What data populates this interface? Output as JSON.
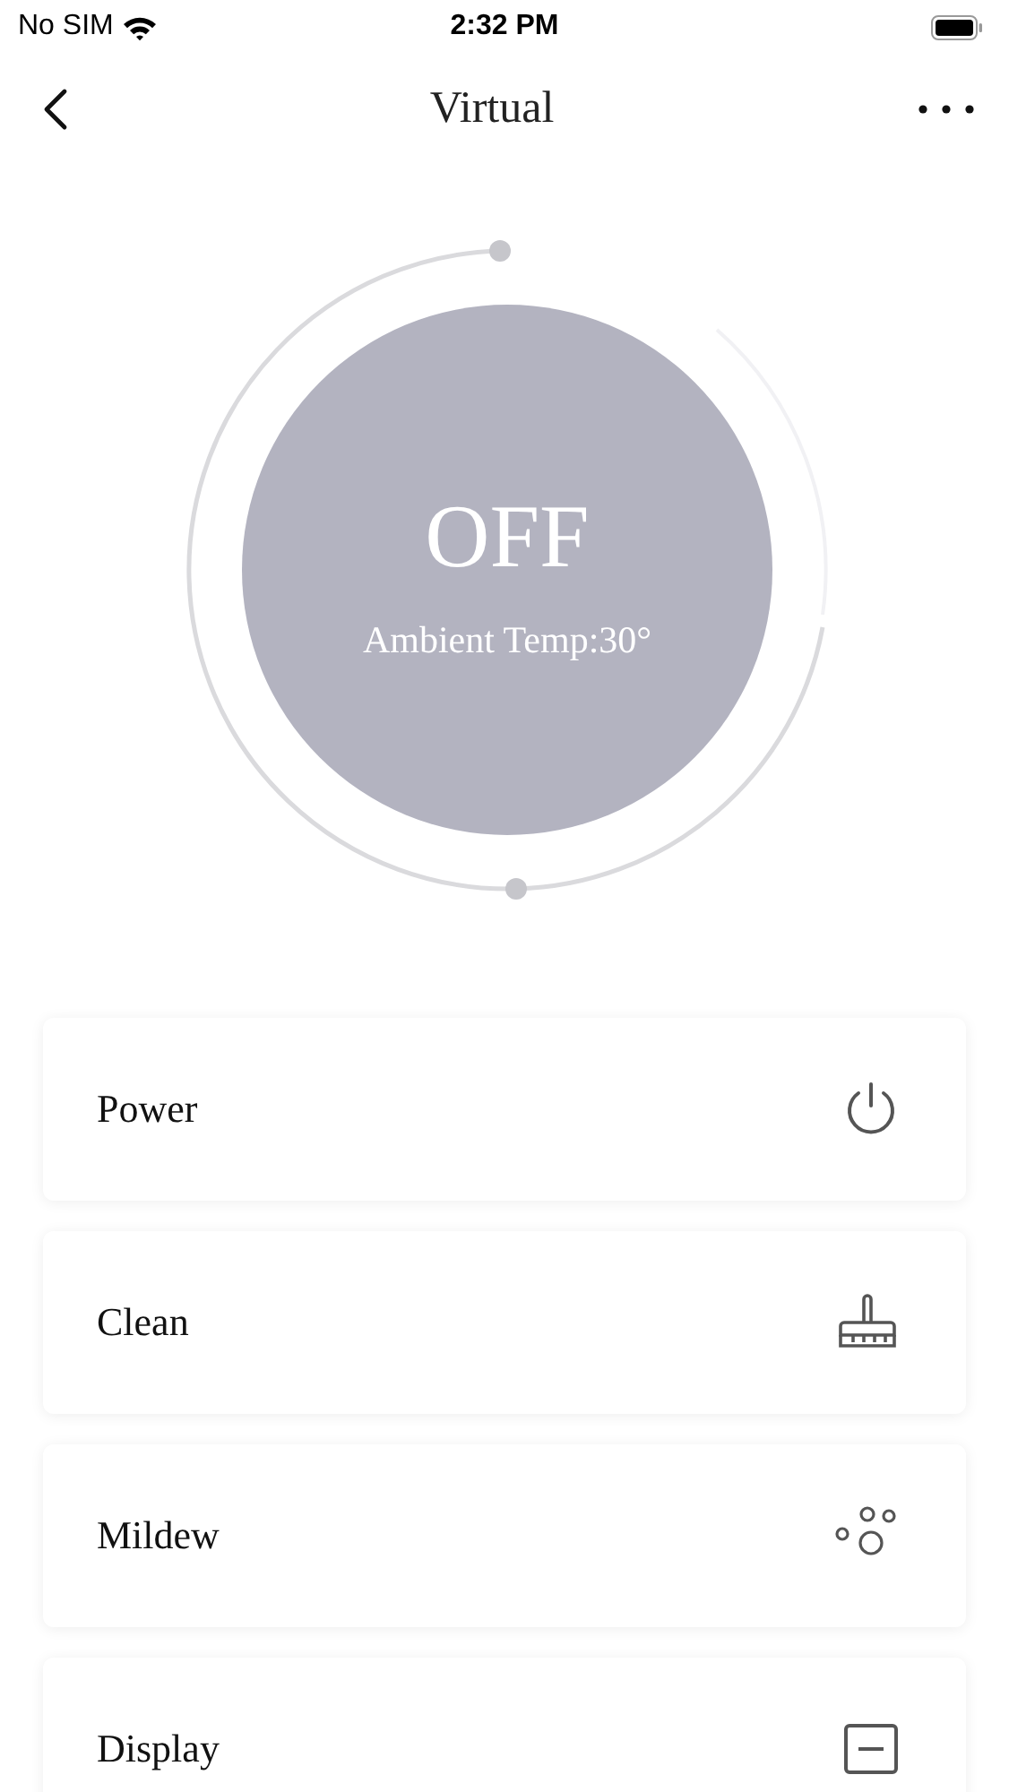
{
  "status_bar": {
    "carrier": "No SIM",
    "time": "2:32 PM"
  },
  "nav": {
    "title": "Virtual"
  },
  "dial": {
    "state": "OFF",
    "ambient": "Ambient Temp:30°"
  },
  "controls": [
    {
      "label": "Power",
      "kind": "power"
    },
    {
      "label": "Clean",
      "kind": "clean"
    },
    {
      "label": "Mildew",
      "kind": "mildew"
    },
    {
      "label": "Display",
      "kind": "display"
    }
  ]
}
